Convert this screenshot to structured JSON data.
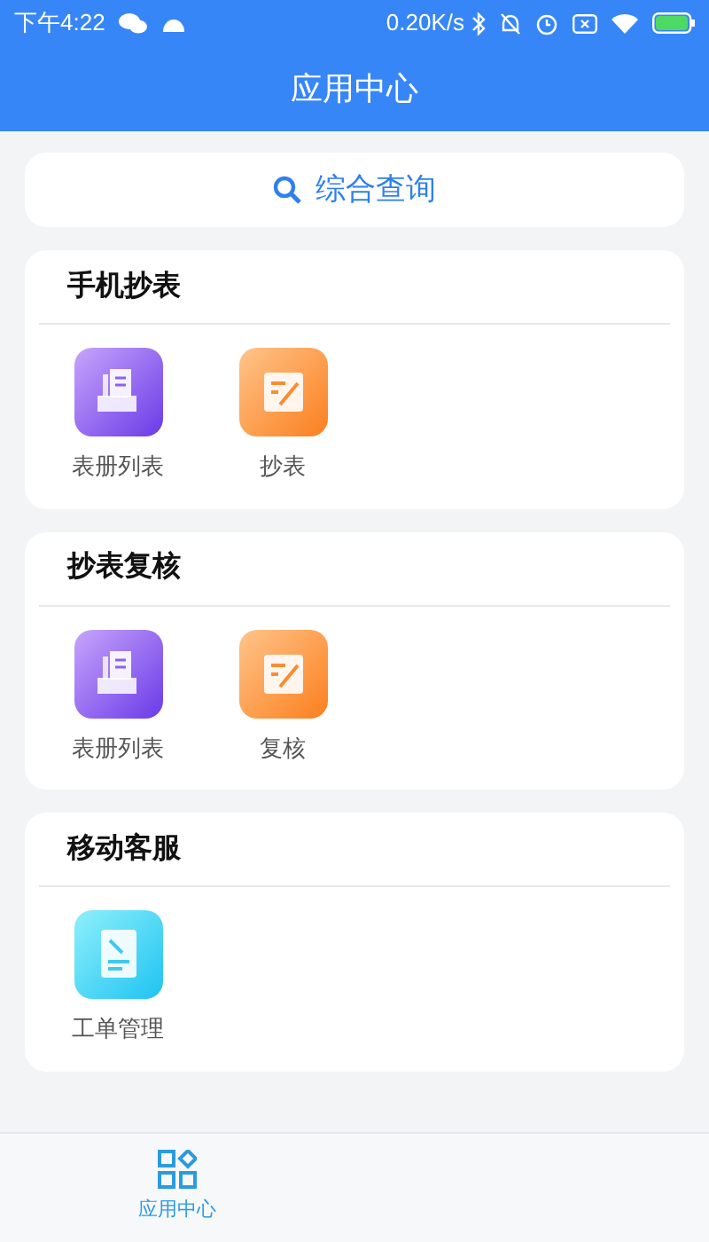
{
  "status_bar": {
    "time": "下午4:22",
    "speed": "0.20K/s"
  },
  "header": {
    "title": "应用中心"
  },
  "search": {
    "label": "综合查询"
  },
  "sections": [
    {
      "title": "手机抄表",
      "apps": [
        {
          "label": "表册列表",
          "kind": "register"
        },
        {
          "label": "抄表",
          "kind": "edit"
        }
      ]
    },
    {
      "title": "抄表复核",
      "apps": [
        {
          "label": "表册列表",
          "kind": "register"
        },
        {
          "label": "复核",
          "kind": "edit"
        }
      ]
    },
    {
      "title": "移动客服",
      "apps": [
        {
          "label": "工单管理",
          "kind": "workorder"
        }
      ]
    }
  ],
  "bottom_nav": [
    {
      "label": "应用中心",
      "selected": true
    }
  ]
}
